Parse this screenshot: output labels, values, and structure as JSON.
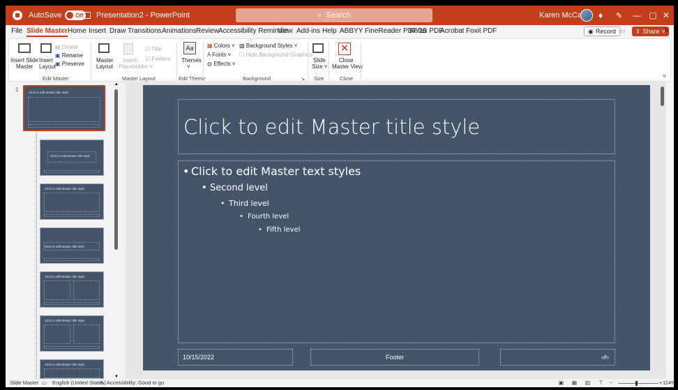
{
  "titlebar": {
    "autosave_label": "AutoSave",
    "autosave_state": "Off",
    "doc_title": "Presentation2 - PowerPoint",
    "search_placeholder": "Search",
    "user_name": "Karen McCall",
    "minimize": "—",
    "restore": "▢",
    "close": "✕"
  },
  "menu": {
    "tabs": [
      "File",
      "Slide Master",
      "Home",
      "Insert",
      "Draw",
      "Transitions",
      "Animations",
      "Review",
      "Accessibility Reminder",
      "View",
      "Add-ins",
      "Help",
      "ABBYY FineReader PDF 15",
      "Kofax PDF",
      "Acrobat",
      "Foxit PDF"
    ],
    "record": "Record",
    "share": "Share"
  },
  "ribbon": {
    "edit_master": {
      "insert_slide_master": [
        "Insert Slide",
        "Master"
      ],
      "insert_layout": [
        "Insert",
        "Layout"
      ],
      "delete": "Delete",
      "rename": "Rename",
      "preserve": "Preserve",
      "label": "Edit Master"
    },
    "master_layout": {
      "master_layout": [
        "Master",
        "Layout"
      ],
      "insert_placeholder": [
        "Insert",
        "Placeholder ˅"
      ],
      "title": "Title",
      "footers": "Footers",
      "label": "Master Layout"
    },
    "edit_theme": {
      "themes": "Themes",
      "label": "Edit Theme"
    },
    "background": {
      "colors": "Colors ˅",
      "fonts": "Fonts ˅",
      "effects": "Effects ˅",
      "background_styles": "Background Styles ˅",
      "hide_background": "Hide Background Graphics",
      "label": "Background"
    },
    "size": {
      "slide_size": [
        "Slide",
        "Size ˅"
      ],
      "label": "Size"
    },
    "close": {
      "close_master_view": [
        "Close",
        "Master View"
      ],
      "label": "Close"
    }
  },
  "thumbs": {
    "number": "1",
    "master_title": "Click to edit Master title style",
    "layout_titles": [
      "Click to edit Master title style",
      "Click to edit Master title style",
      "Click to edit Master title style",
      "Click to edit Master title style",
      "Click to edit Master title style",
      "Click to edit Master title style"
    ]
  },
  "slide": {
    "title": "Click to edit Master title style",
    "levels": [
      "Click to edit Master text styles",
      "Second level",
      "Third level",
      "Fourth level",
      "Fifth level"
    ],
    "date": "10/15/2022",
    "footer": "Footer",
    "page_number": "‹#›"
  },
  "status": {
    "view": "Slide Master",
    "language": "English (United States)",
    "accessibility": "Accessibility: Good to go",
    "zoom": "114%"
  },
  "colors": {
    "accent": "#c43e1c",
    "slide_bg": "#44546a"
  }
}
